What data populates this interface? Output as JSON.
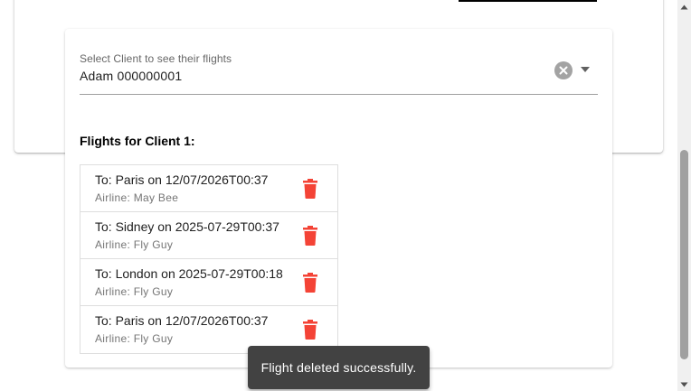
{
  "client_select": {
    "label": "Select Client to see their flights",
    "value": "Adam 000000001",
    "clear_icon": "clear-circle-icon",
    "dropdown_icon": "caret-down-icon"
  },
  "flights_heading": "Flights for Client 1:",
  "flights": [
    {
      "title": "To: Paris on 12/07/2026T00:37",
      "airline": "Airline: May Bee"
    },
    {
      "title": "To: Sidney on 2025-07-29T00:37",
      "airline": "Airline: Fly Guy"
    },
    {
      "title": "To: London on 2025-07-29T00:18",
      "airline": "Airline: Fly Guy"
    },
    {
      "title": "To: Paris on 12/07/2026T00:37",
      "airline": "Airline: Fly Guy"
    }
  ],
  "delete_icon": "trash-icon",
  "colors": {
    "delete": "#f44336",
    "snackbar_bg": "#424242"
  },
  "snackbar": {
    "message": "Flight deleted successfully."
  }
}
